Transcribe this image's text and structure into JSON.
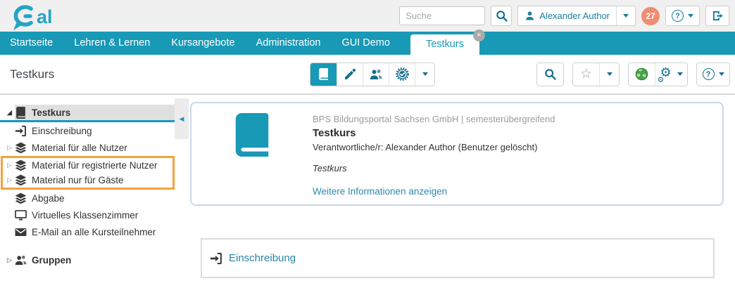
{
  "header": {
    "logo_text": "al",
    "search_placeholder": "Suche",
    "user_name": "Alexander Author",
    "notification_count": "27"
  },
  "nav": {
    "items": [
      "Startseite",
      "Lehren & Lernen",
      "Kursangebote",
      "Administration",
      "GUI Demo"
    ],
    "active_tab": "Testkurs"
  },
  "toolbar": {
    "page_title": "Testkurs"
  },
  "sidebar": {
    "items": [
      {
        "label": "Testkurs",
        "icon": "book",
        "state": "selected-expanded"
      },
      {
        "label": "Einschreibung",
        "icon": "sign-in"
      },
      {
        "label": "Material für alle Nutzer",
        "icon": "layers",
        "state": "collapsed"
      },
      {
        "label": "Material für registrierte Nutzer",
        "icon": "layers",
        "state": "collapsed",
        "highlighted": true
      },
      {
        "label": "Material nur für Gäste",
        "icon": "layers",
        "state": "collapsed",
        "highlighted": true
      },
      {
        "label": "Abgabe",
        "icon": "layers"
      },
      {
        "label": "Virtuelles Klassenzimmer",
        "icon": "display"
      },
      {
        "label": "E-Mail an alle Kursteilnehmer",
        "icon": "envelope"
      },
      {
        "label": "Gruppen",
        "icon": "users",
        "state": "collapsed",
        "bold": true
      }
    ]
  },
  "main": {
    "course_card": {
      "meta": "BPS Bildungsportal Sachsen GmbH | semesterübergreifend",
      "title": "Testkurs",
      "responsible": "Verantwortliche/r: Alexander Author (Benutzer gelöscht)",
      "description": "Testkurs",
      "more_link": "Weitere Informationen anzeigen"
    },
    "enrollment": {
      "label": "Einschreibung"
    }
  },
  "icons": {
    "close_glyph": "×",
    "star_glyph": "☆",
    "gear_glyph": "⚙",
    "question_glyph": "?",
    "caret_collapsed": "▷",
    "caret_expanded": "◢",
    "collapse_handle": "◀"
  },
  "colors": {
    "accent_teal": "#1899b6",
    "icon_teal": "#166e8e",
    "badge_salmon": "#f08c72",
    "highlight_orange": "#f3a23d",
    "link_blue": "#2d89ae",
    "card_border": "#c9d7e8"
  }
}
